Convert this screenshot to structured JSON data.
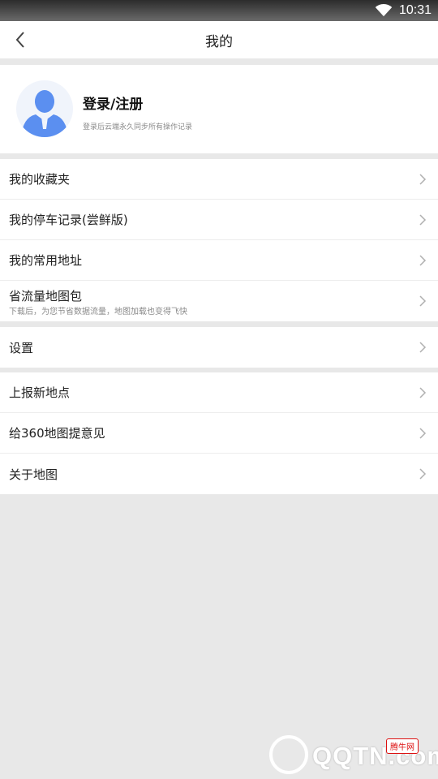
{
  "status_bar": {
    "time": "10:31"
  },
  "header": {
    "title": "我的"
  },
  "profile": {
    "login_label": "登录/注册",
    "login_subtitle": "登录后云端永久同步所有操作记录"
  },
  "menu_groups": [
    [
      {
        "label": "我的收藏夹"
      },
      {
        "label": "我的停车记录(尝鲜版)"
      },
      {
        "label": "我的常用地址"
      },
      {
        "label": "省流量地图包",
        "sub": "下载后，为您节省数据流量，地图加载也变得飞快"
      }
    ],
    [
      {
        "label": "设置"
      }
    ],
    [
      {
        "label": "上报新地点"
      },
      {
        "label": "给360地图提意见"
      },
      {
        "label": "关于地图"
      }
    ]
  ],
  "watermark": {
    "text": "QQTN.com",
    "badge": "腾牛网"
  },
  "colors": {
    "background": "#e8e8e8",
    "card": "#ffffff",
    "avatar_blue": "#5b8ff0",
    "chevron": "#b0b0b0"
  },
  "icons": {
    "back": "chevron-left-icon",
    "wifi": "wifi-icon",
    "row_arrow": "chevron-right-icon",
    "avatar": "user-silhouette-icon"
  }
}
